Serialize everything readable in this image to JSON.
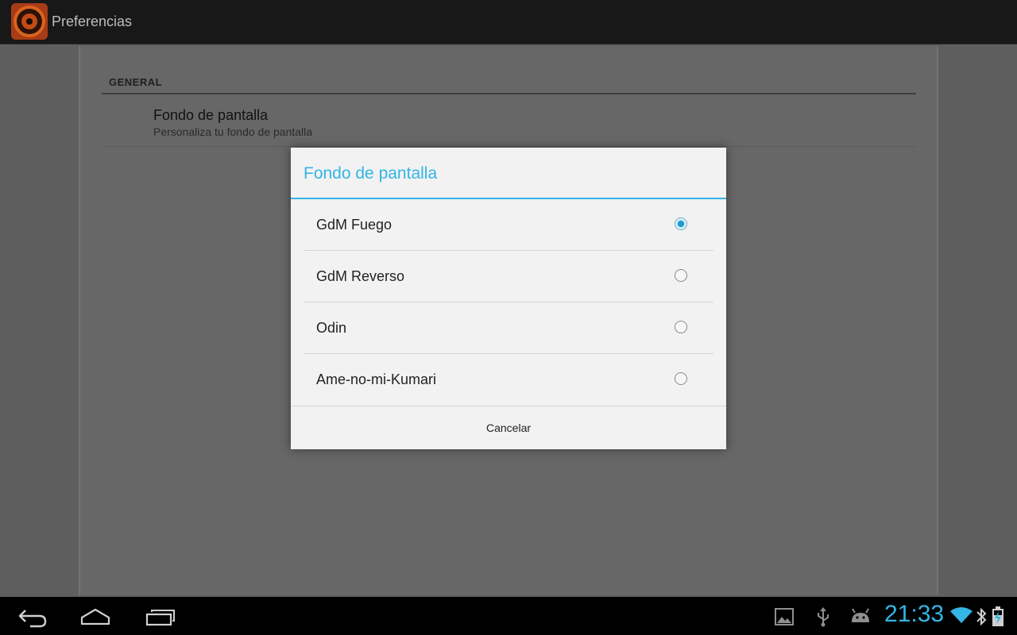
{
  "action_bar": {
    "title": "Preferencias",
    "app_icon": "app-logo-icon"
  },
  "preferences": {
    "section_header": "GENERAL",
    "item": {
      "title": "Fondo de pantalla",
      "summary": "Personaliza tu fondo de pantalla"
    }
  },
  "dialog": {
    "title": "Fondo de pantalla",
    "options": [
      {
        "label": "GdM Fuego",
        "selected": true
      },
      {
        "label": "GdM Reverso",
        "selected": false
      },
      {
        "label": "Odin",
        "selected": false
      },
      {
        "label": "Ame-no-mi-Kumari",
        "selected": false
      }
    ],
    "cancel_label": "Cancelar"
  },
  "system_bar": {
    "clock": "21:33",
    "nav_icons": [
      "back-icon",
      "home-icon",
      "recent-apps-icon"
    ],
    "status_icons": [
      "gallery-notification-icon",
      "usb-icon",
      "android-debug-icon",
      "wifi-icon",
      "bluetooth-icon",
      "battery-charging-icon"
    ]
  },
  "colors": {
    "accent": "#33b5e5",
    "dialog_background": "#f2f2f2",
    "system_bar": "#000000"
  }
}
